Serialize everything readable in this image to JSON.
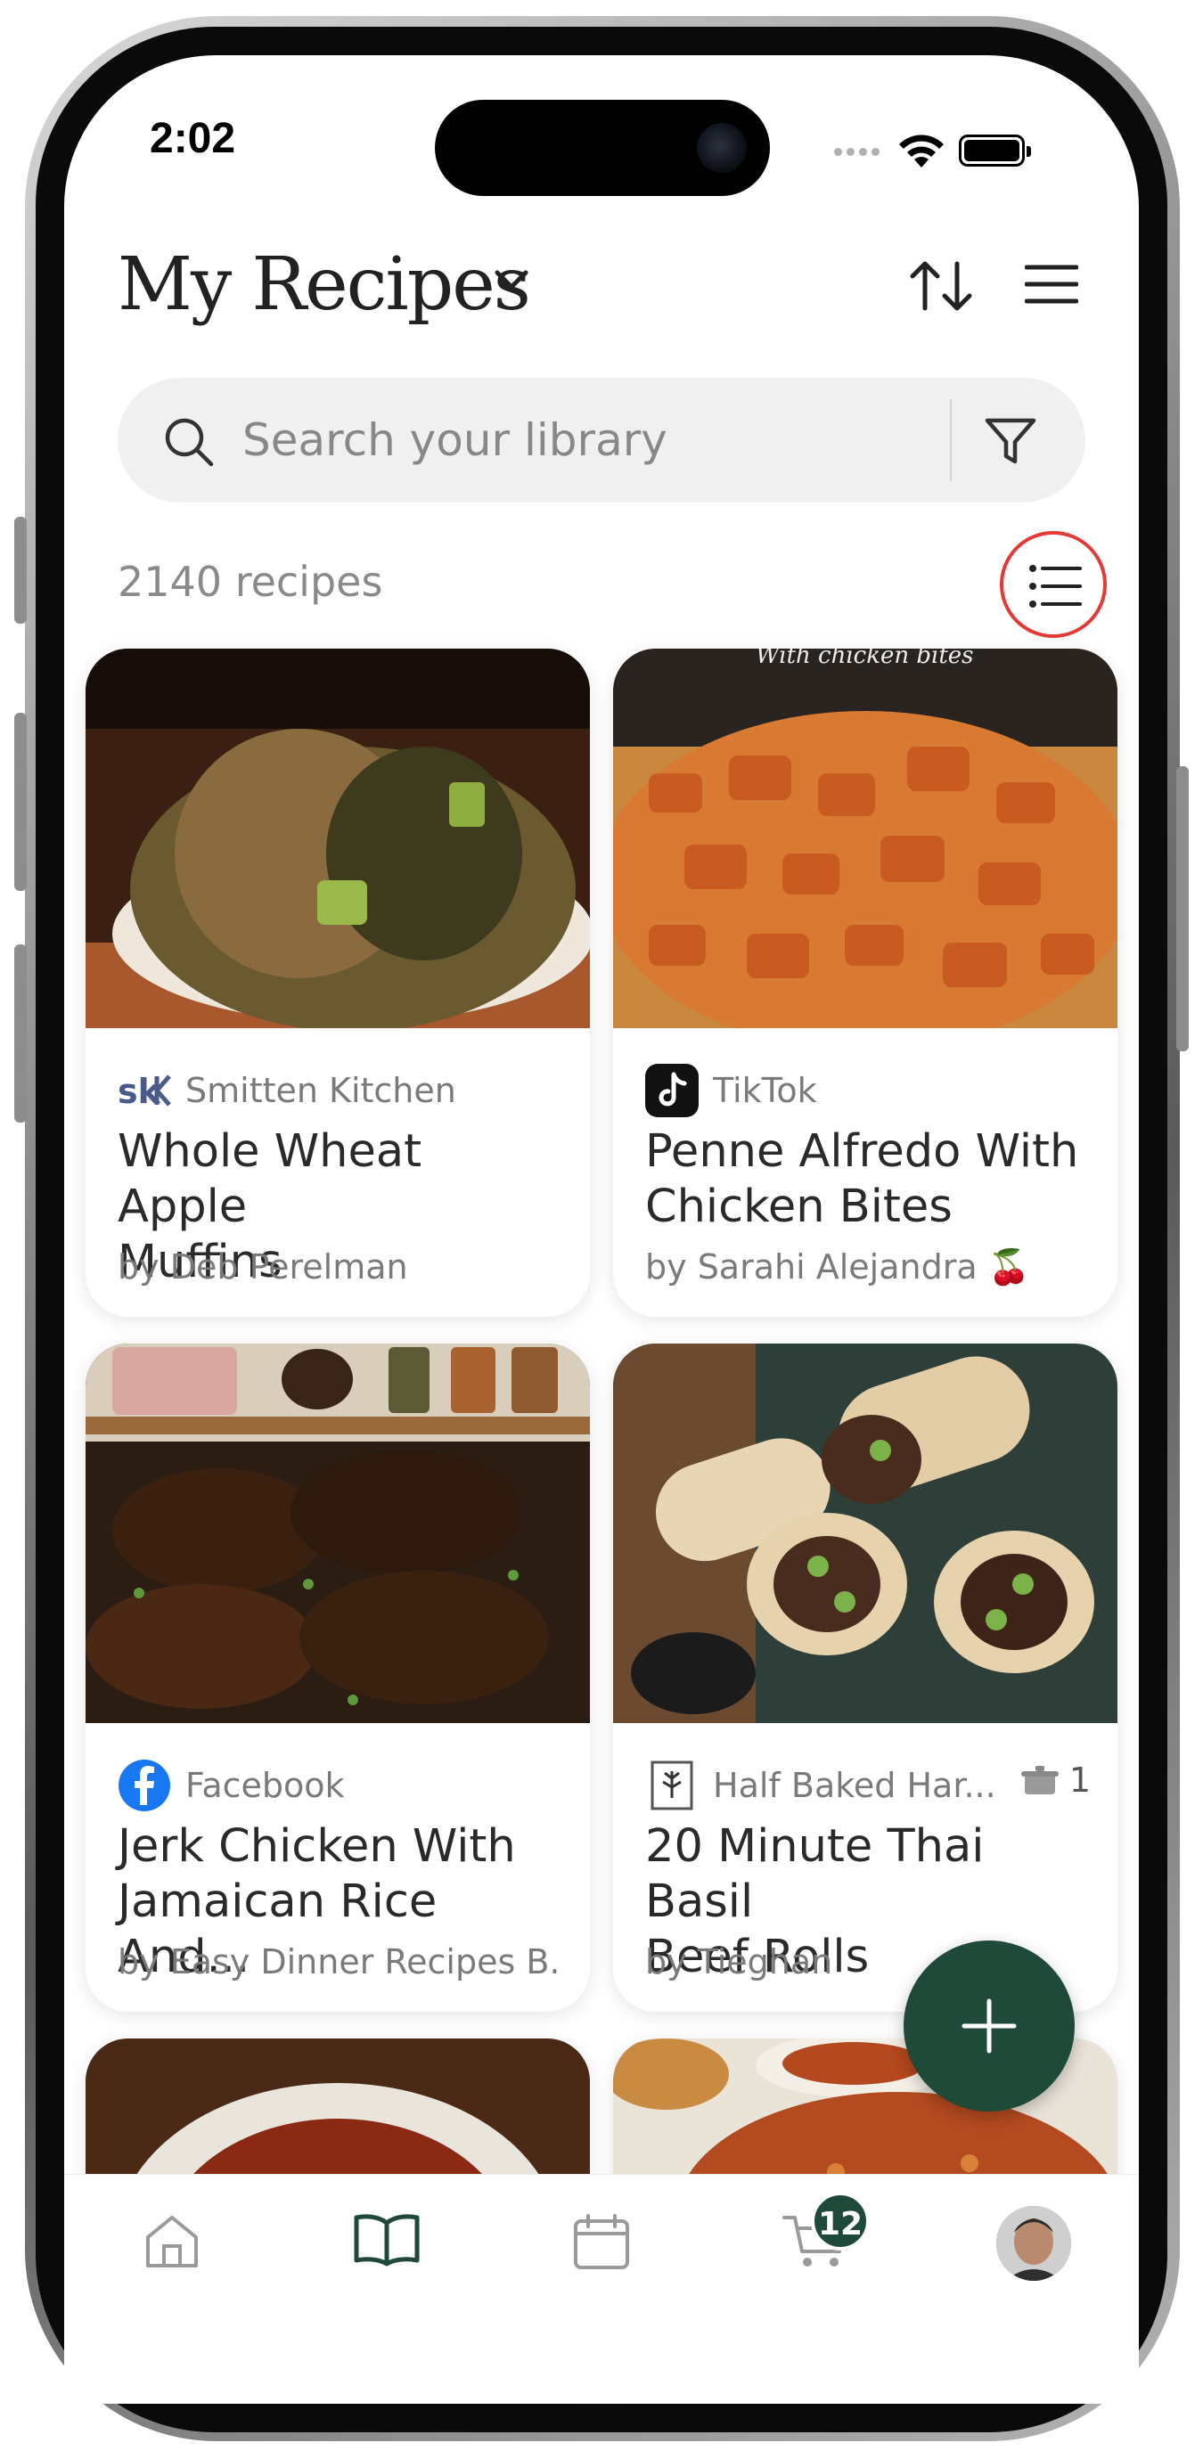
{
  "status": {
    "time": "2:02"
  },
  "header": {
    "title": "My Recipes"
  },
  "search": {
    "placeholder": "Search your library"
  },
  "library": {
    "count_label": "2140 recipes"
  },
  "recipes": [
    {
      "source": "Smitten Kitchen",
      "title": "Whole Wheat Apple\nMuffins",
      "author": "by Deb Perelman"
    },
    {
      "source": "TikTok",
      "title": "Penne Alfredo With\nChicken Bites",
      "author": "by Sarahi Alejandra 🍒"
    },
    {
      "source": "Facebook",
      "title": "Jerk Chicken With\nJamaican Rice And...",
      "author": "by Easy Dinner Recipes B..."
    },
    {
      "source": "Half Baked Har...",
      "title": "20 Minute Thai Basil\nBeef Rolls",
      "author": "by Tieghan",
      "cooked_count": "1"
    }
  ],
  "photo_overlays": {
    "card2_caption": "With chicken bites"
  },
  "tabbar": {
    "tabs": [
      "home-icon",
      "book-icon",
      "calendar-icon",
      "cart-icon",
      "avatar"
    ],
    "active": "book-icon",
    "cart_badge": "12"
  },
  "colors": {
    "accent": "#1f4a3a",
    "highlight_ring": "#e53935"
  }
}
